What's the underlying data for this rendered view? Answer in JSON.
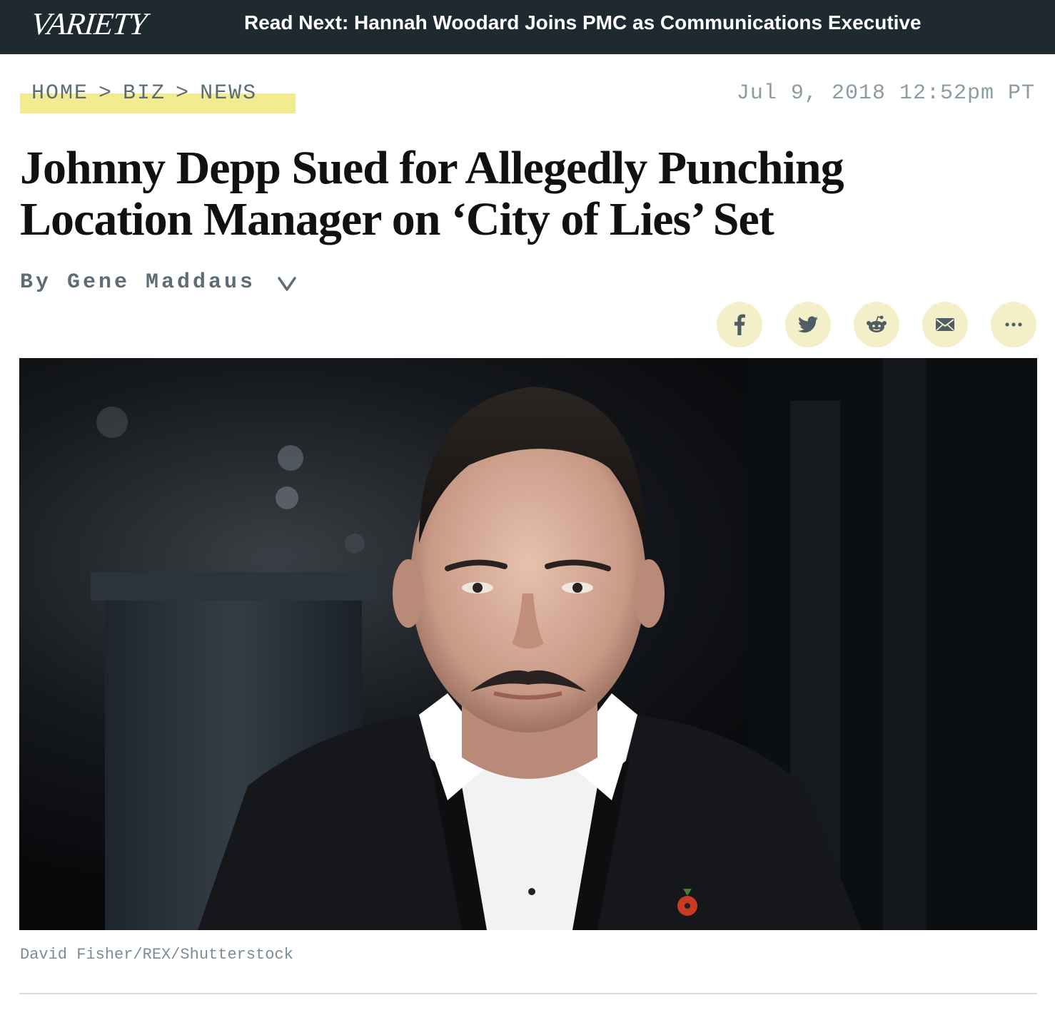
{
  "header": {
    "logo": "VARIETY",
    "read_next": "Read Next: Hannah Woodard Joins PMC as Communications Executive"
  },
  "breadcrumb": {
    "items": [
      "HOME",
      "BIZ",
      "NEWS"
    ],
    "separator": ">"
  },
  "timestamp": "Jul 9, 2018 12:52pm PT",
  "article": {
    "headline_line1": "Johnny Depp Sued for Allegedly Punching",
    "headline_line2": "Location Manager on ‘City of Lies’ Set",
    "byline": "By Gene Maddaus"
  },
  "share": {
    "buttons": [
      "facebook-icon",
      "twitter-icon",
      "reddit-icon",
      "email-icon",
      "more-icon"
    ]
  },
  "image": {
    "caption": "David Fisher/REX/Shutterstock"
  },
  "colors": {
    "topbar": "#1f2a30",
    "highlight": "#f2ec8f",
    "share_bg": "#f3f0c9",
    "muted_text": "#5d6d76"
  }
}
